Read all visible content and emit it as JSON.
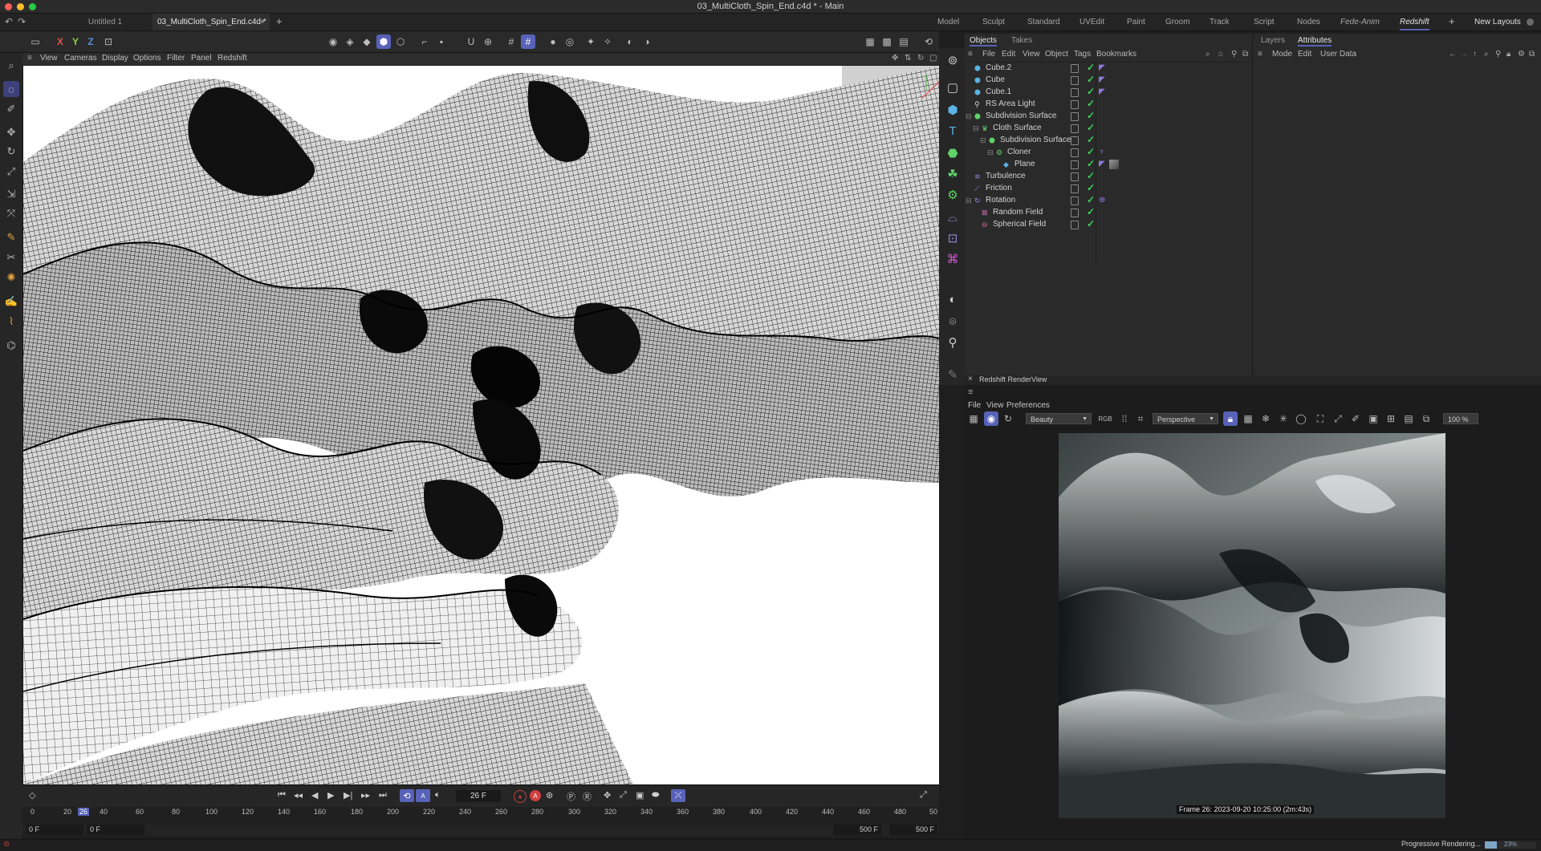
{
  "window": {
    "title": "03_MultiCloth_Spin_End.c4d * - Main"
  },
  "doc_tabs": [
    {
      "label": "Untitled 1"
    },
    {
      "label": "03_MultiCloth_Spin_End.c4d *"
    }
  ],
  "layouts": [
    "Model",
    "Sculpt",
    "Standard",
    "UVEdit",
    "Paint",
    "Groom",
    "Track",
    "Script",
    "Nodes",
    "Fede-Anim",
    "Redshift"
  ],
  "active_layout": "Redshift",
  "new_layouts_label": "New Layouts",
  "axis": {
    "x": "X",
    "y": "Y",
    "z": "Z"
  },
  "viewport_menu": [
    "View",
    "Cameras",
    "Display",
    "Options",
    "Filter",
    "Panel",
    "Redshift"
  ],
  "timeline": {
    "current_frame": "26 F",
    "ruler_ticks": [
      "0",
      "20",
      "26",
      "40",
      "60",
      "80",
      "100",
      "120",
      "140",
      "160",
      "180",
      "200",
      "220",
      "240",
      "260",
      "280",
      "300",
      "320",
      "340",
      "360",
      "380",
      "400",
      "420",
      "440",
      "460",
      "480",
      "50"
    ],
    "start_a": "0 F",
    "start_b": "0 F",
    "end_a": "500 F",
    "end_b": "500 F"
  },
  "object_manager": {
    "tabs": [
      "Objects",
      "Takes"
    ],
    "menu": [
      "File",
      "Edit",
      "View",
      "Object",
      "Tags",
      "Bookmarks"
    ],
    "objects": [
      {
        "name": "Cube.2",
        "indent": 0
      },
      {
        "name": "Cube",
        "indent": 0
      },
      {
        "name": "Cube.1",
        "indent": 0
      },
      {
        "name": "RS Area Light",
        "indent": 0
      },
      {
        "name": "Subdivision Surface",
        "indent": 0
      },
      {
        "name": "Cloth Surface",
        "indent": 1
      },
      {
        "name": "Subdivision Surface",
        "indent": 2
      },
      {
        "name": "Cloner",
        "indent": 3
      },
      {
        "name": "Plane",
        "indent": 4
      },
      {
        "name": "Turbulence",
        "indent": 0
      },
      {
        "name": "Friction",
        "indent": 0
      },
      {
        "name": "Rotation",
        "indent": 0
      },
      {
        "name": "Random Field",
        "indent": 1
      },
      {
        "name": "Spherical Field",
        "indent": 1
      }
    ]
  },
  "attributes": {
    "tabs": [
      "Layers",
      "Attributes"
    ],
    "menu": [
      "Mode",
      "Edit",
      "User Data"
    ]
  },
  "render_view": {
    "title": "Redshift RenderView",
    "menu": [
      "File",
      "View",
      "Preferences"
    ],
    "aov": "Beauty",
    "camera": "Perspective",
    "zoom": "100 %",
    "frame_info": "Frame  26:  2023-09-20  10:25:00  (2m:43s)",
    "status": "Progressive Rendering...",
    "progress_label": "23%",
    "progress": 0.23
  },
  "colors": {
    "accent": "#5862b8",
    "check": "#3fd25a",
    "tag": "#8f7ad8"
  }
}
